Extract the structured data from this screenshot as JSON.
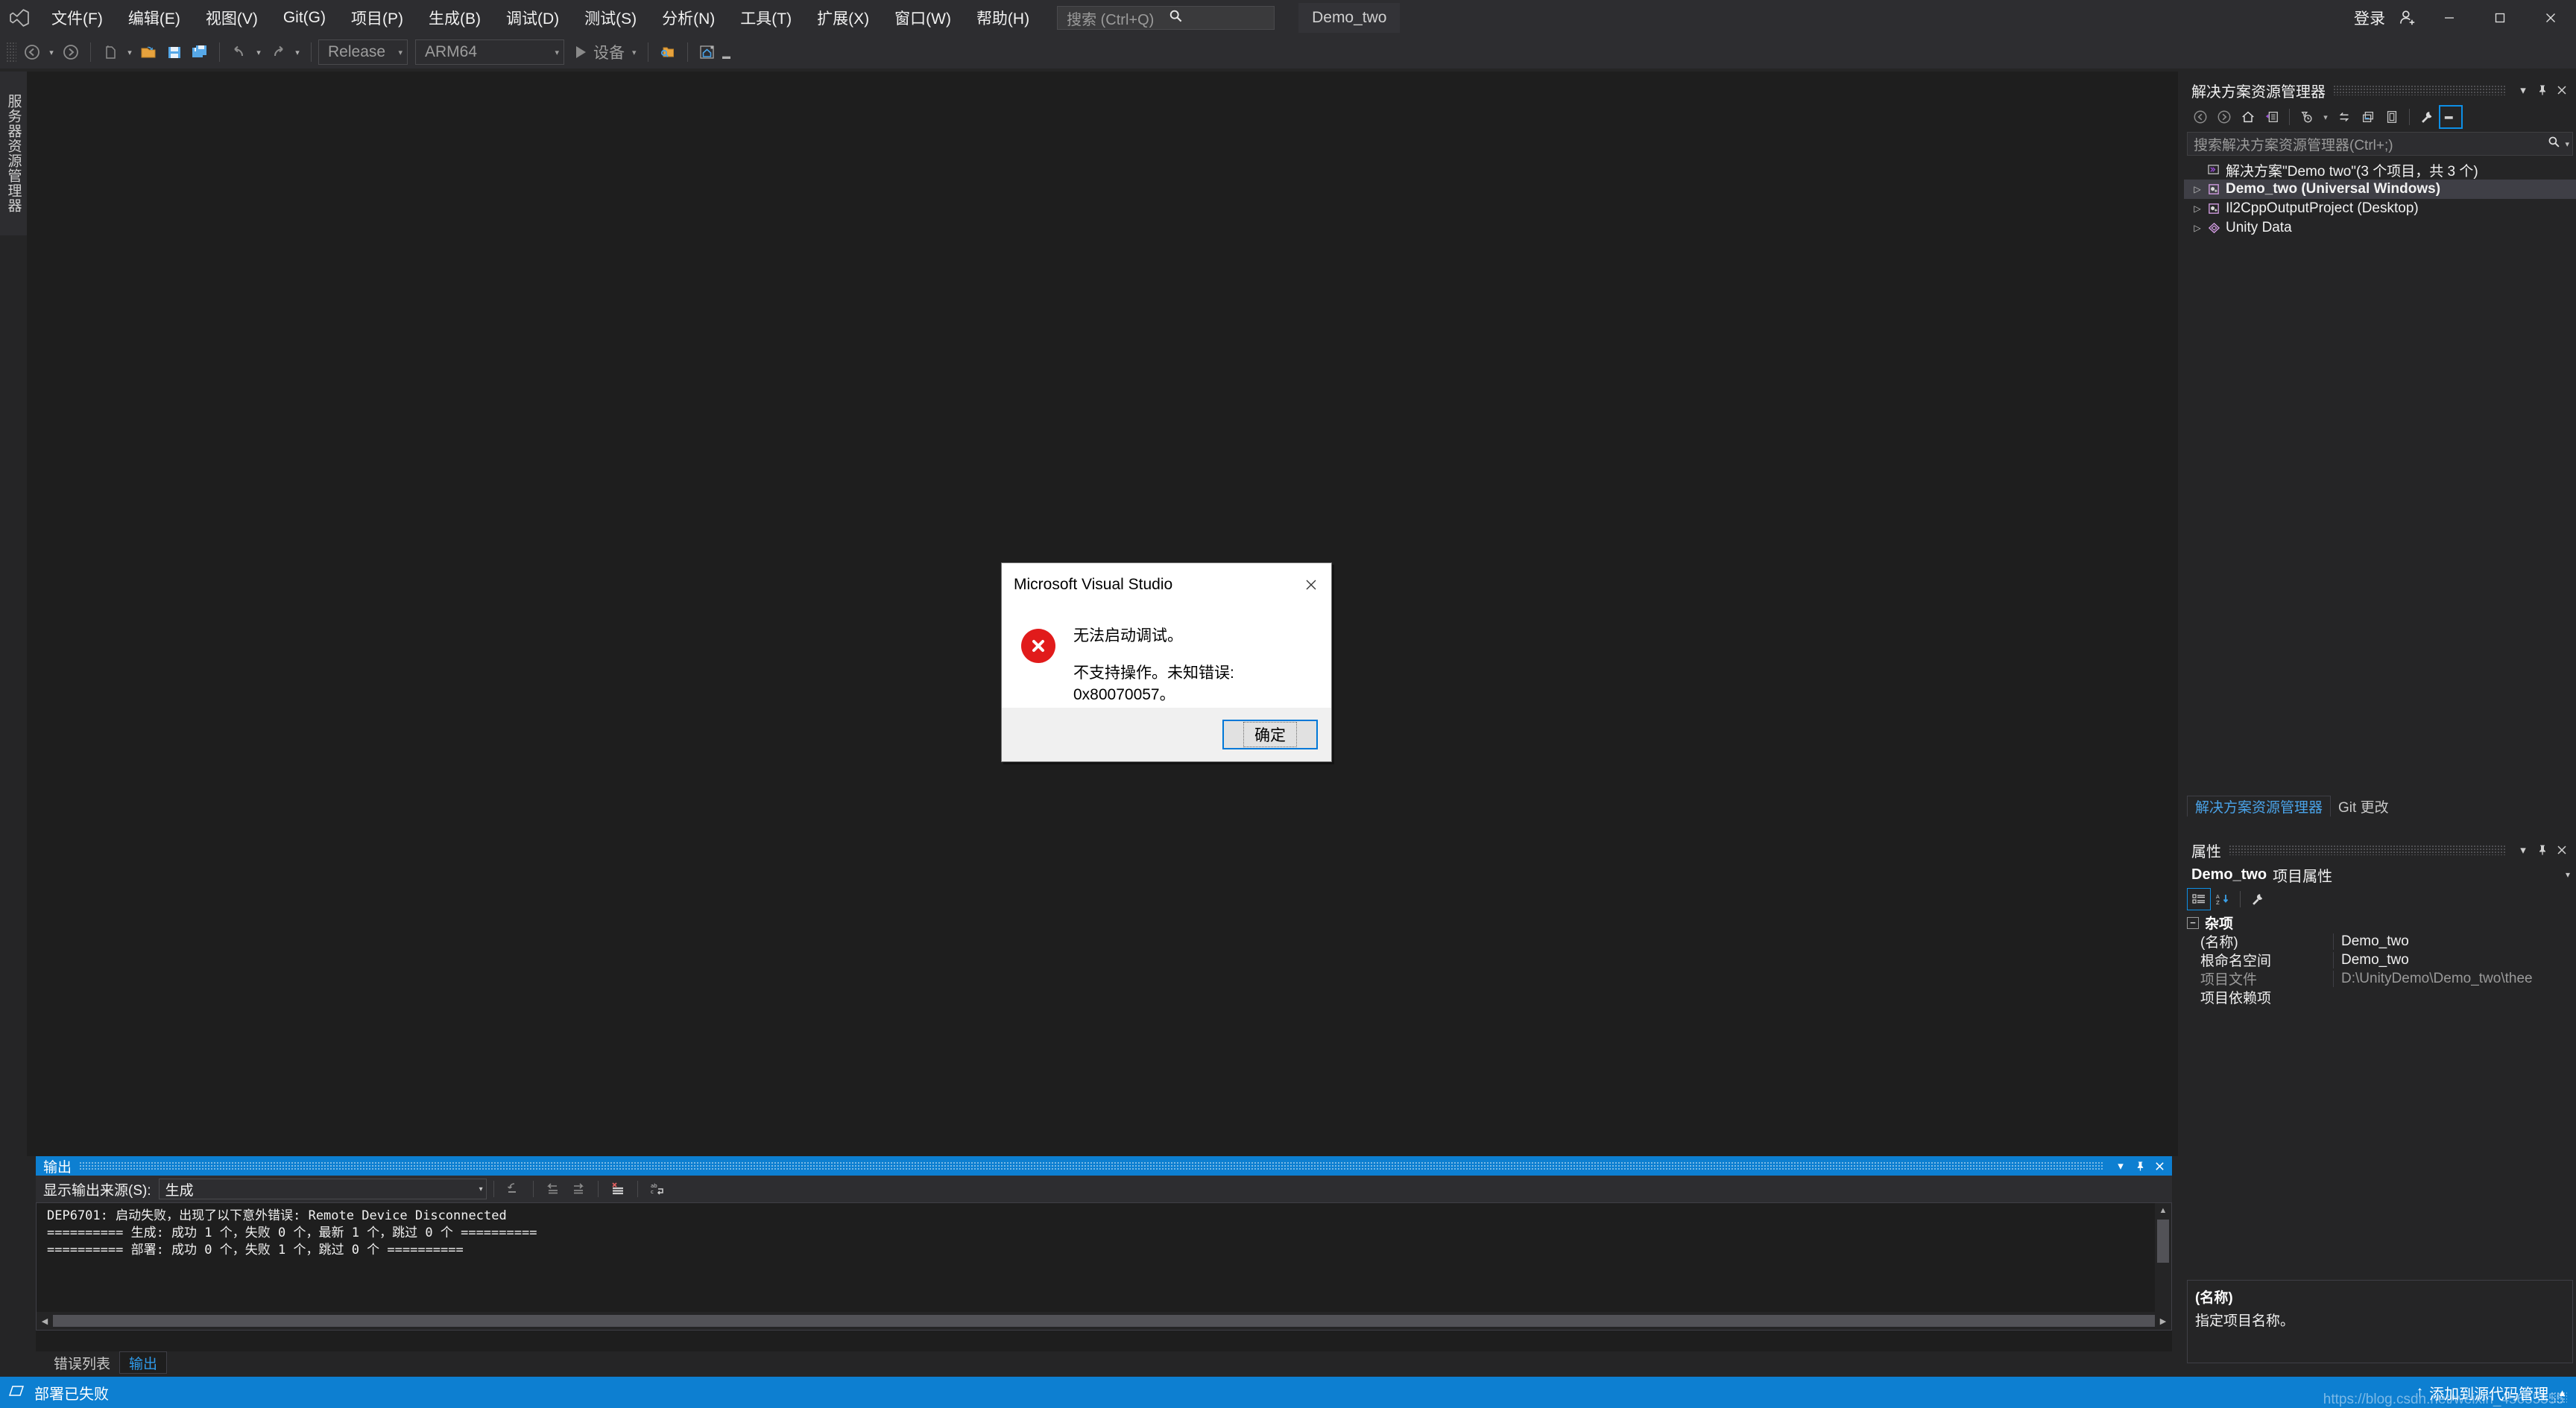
{
  "window": {
    "title": "Demo_two",
    "signin_label": "登录",
    "minimize": "—",
    "maximize": "□",
    "close": "✕"
  },
  "menu": {
    "items": [
      {
        "label": "文件(F)",
        "name": "menu-file"
      },
      {
        "label": "编辑(E)",
        "name": "menu-edit"
      },
      {
        "label": "视图(V)",
        "name": "menu-view"
      },
      {
        "label": "Git(G)",
        "name": "menu-git"
      },
      {
        "label": "项目(P)",
        "name": "menu-project"
      },
      {
        "label": "生成(B)",
        "name": "menu-build"
      },
      {
        "label": "调试(D)",
        "name": "menu-debug"
      },
      {
        "label": "测试(S)",
        "name": "menu-test"
      },
      {
        "label": "分析(N)",
        "name": "menu-analyze"
      },
      {
        "label": "工具(T)",
        "name": "menu-tools"
      },
      {
        "label": "扩展(X)",
        "name": "menu-extensions"
      },
      {
        "label": "窗口(W)",
        "name": "menu-window"
      },
      {
        "label": "帮助(H)",
        "name": "menu-help"
      }
    ],
    "quick_search_placeholder": "搜索 (Ctrl+Q)"
  },
  "toolbar": {
    "configuration": "Release",
    "platform": "ARM64",
    "run_target": "设备"
  },
  "left_dock": {
    "server_explorer_tab": "服务器资源管理器"
  },
  "solution_explorer": {
    "title": "解决方案资源管理器",
    "search_placeholder": "搜索解决方案资源管理器(Ctrl+;)",
    "tree": [
      {
        "label": "解决方案\"Demo two\"(3 个项目，共 3 个)",
        "icon": "solution-icon",
        "indent": 0,
        "expandable": false,
        "selected": false,
        "bold": false
      },
      {
        "label": "Demo_two (Universal Windows)",
        "icon": "project-icon",
        "indent": 1,
        "expandable": true,
        "selected": true,
        "bold": true
      },
      {
        "label": "Il2CppOutputProject (Desktop)",
        "icon": "project-icon",
        "indent": 1,
        "expandable": true,
        "selected": false,
        "bold": false
      },
      {
        "label": "Unity Data",
        "icon": "unity-icon",
        "indent": 1,
        "expandable": true,
        "selected": false,
        "bold": false
      }
    ],
    "tabs": [
      {
        "label": "解决方案资源管理器",
        "active": true
      },
      {
        "label": "Git 更改",
        "active": false
      }
    ]
  },
  "properties": {
    "title": "属性",
    "object_name": "Demo_two",
    "object_type": "项目属性",
    "category": "杂项",
    "rows": [
      {
        "key": "(名称)",
        "value": "Demo_two",
        "dim": false
      },
      {
        "key": "根命名空间",
        "value": "Demo_two",
        "dim": false
      },
      {
        "key": "项目文件",
        "value": "D:\\UnityDemo\\Demo_two\\thee",
        "dim": true
      },
      {
        "key": "项目依赖项",
        "value": "",
        "dim": false
      }
    ],
    "description_title": "(名称)",
    "description_text": "指定项目名称。"
  },
  "output": {
    "title": "输出",
    "source_label": "显示输出来源(S):",
    "source_value": "生成",
    "lines": [
      "DEP6701: 启动失败，出现了以下意外错误: Remote Device Disconnected",
      "========== 生成: 成功 1 个，失败 0 个，最新 1 个，跳过 0 个 ==========",
      "========== 部署: 成功 0 个，失败 1 个，跳过 0 个 =========="
    ]
  },
  "bottom_tabs": [
    {
      "label": "错误列表",
      "active": false
    },
    {
      "label": "输出",
      "active": true
    }
  ],
  "statusbar": {
    "left_text": "部署已失败",
    "right_text": "添加到源代码管理",
    "right_up_arrow": "↑",
    "right_caret": "▲",
    "watermark": "https://blog.csdn.net/weixin_45655555"
  },
  "dialog": {
    "title": "Microsoft Visual Studio",
    "close": "✕",
    "message_line1": "无法启动调试。",
    "message_line2": "不支持操作。未知错误: 0x80070057。",
    "ok_label": "确定"
  },
  "colors": {
    "accent": "#0d7fd1",
    "error_red": "#e11b1b",
    "link_blue": "#2f9bea",
    "chrome": "#2d2d30",
    "panel": "#252526",
    "editor": "#1e1e1e"
  }
}
